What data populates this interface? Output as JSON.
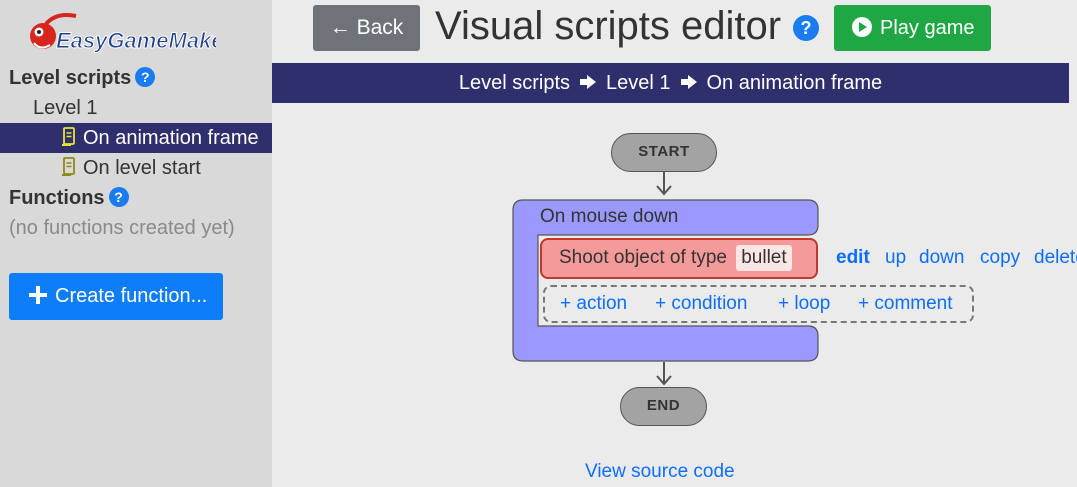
{
  "app": {
    "logo_text": "EasyGameMaker"
  },
  "header": {
    "back_label": "Back",
    "title": "Visual scripts editor",
    "help_label": "?",
    "play_label": "Play game"
  },
  "sidebar": {
    "level_scripts_heading": "Level scripts",
    "level_name": "Level 1",
    "scripts": [
      {
        "label": "On animation frame",
        "selected": true
      },
      {
        "label": "On level start",
        "selected": false
      }
    ],
    "functions_heading": "Functions",
    "functions_empty": "(no functions created yet)",
    "create_function_label": "Create function...",
    "help_label": "?"
  },
  "breadcrumb": {
    "items": [
      "Level scripts",
      "Level 1",
      "On animation frame"
    ]
  },
  "flow": {
    "start_label": "START",
    "end_label": "END",
    "event_label": "On mouse down",
    "action": {
      "text": "Shoot object of type",
      "param": "bullet"
    },
    "action_links": {
      "edit": "edit",
      "up": "up",
      "down": "down",
      "copy": "copy",
      "delete": "delete"
    },
    "add_links": {
      "action": "+ action",
      "condition": "+ condition",
      "loop": "+ loop",
      "comment": "+ comment"
    }
  },
  "footer": {
    "view_source_label": "View source code"
  },
  "colors": {
    "sidebar_bg": "#d9d9d9",
    "main_bg": "#ebebeb",
    "navy": "#2f2f6e",
    "link_blue": "#0d6efd",
    "primary_blue": "#0d7dfa",
    "play_green": "#1fa744",
    "back_gray": "#6d7378",
    "event_block": "#9999ff",
    "action_block": "#f59a9a",
    "action_border": "#c0392b"
  }
}
